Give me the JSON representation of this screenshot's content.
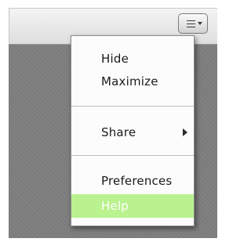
{
  "toolbar": {
    "menu_button_icon": "hamburger-menu-icon",
    "menu_button_caret_icon": "caret-down-icon"
  },
  "menu": {
    "items": [
      {
        "label": "Hide"
      },
      {
        "label": "Maximize"
      },
      {
        "label": "Share",
        "has_submenu": true,
        "submenu_icon": "submenu-arrow-icon"
      },
      {
        "label": "Preferences"
      },
      {
        "label": "Help",
        "highlighted": true
      }
    ]
  },
  "colors": {
    "highlight": "#b9f28e",
    "panel_background": "#7c7c7c",
    "menu_background": "#fcfcfc"
  }
}
